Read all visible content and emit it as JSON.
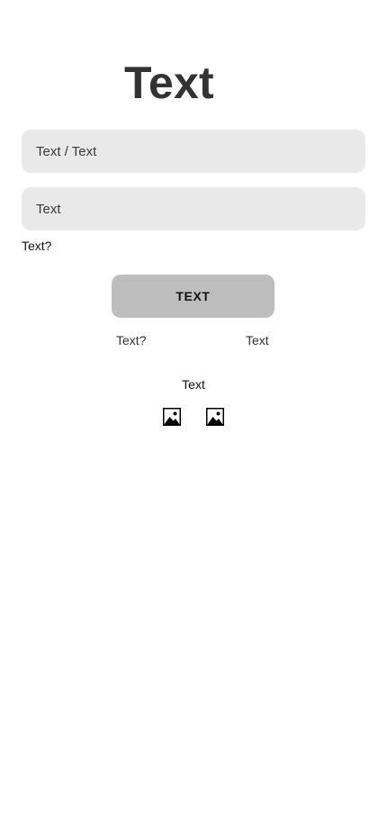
{
  "header": {
    "title": "Text"
  },
  "form": {
    "field_1": {
      "placeholder": "Text / Text"
    },
    "field_2": {
      "placeholder": "Text"
    },
    "helper_link": "Text?",
    "submit_label": "TEXT"
  },
  "links": {
    "left": "Text?",
    "right": "Text"
  },
  "alternative": {
    "label": "Text",
    "icons": [
      "image-icon",
      "image-icon"
    ]
  },
  "colors": {
    "field_bg": "#e9e9e9",
    "button_bg": "#bdbdbd",
    "title": "#333333"
  }
}
